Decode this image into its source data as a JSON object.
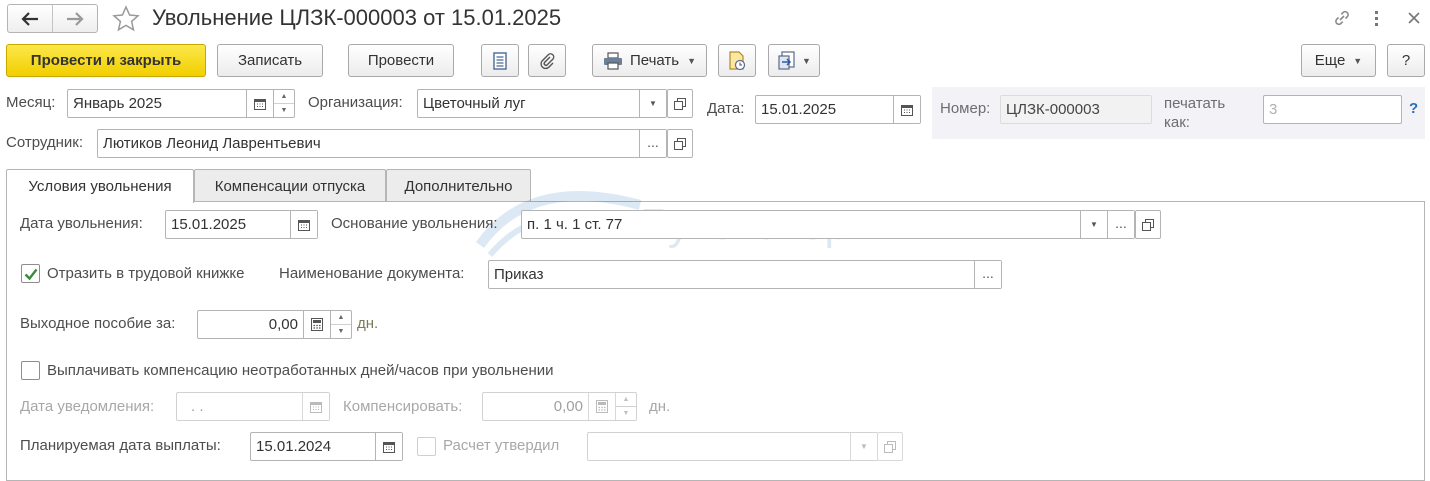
{
  "window": {
    "title": "Увольнение ЦЛЗК-000003 от 15.01.2025",
    "link_icon": "link-icon",
    "more_icon": "vertical-dots-icon",
    "close_icon": "close-icon"
  },
  "toolbar": {
    "post_close_label": "Провести и закрыть",
    "save_label": "Записать",
    "post_label": "Провести",
    "print_label": "Печать",
    "more_label": "Еще",
    "help_label": "?"
  },
  "header": {
    "month_label": "Месяц:",
    "month_value": "Январь 2025",
    "org_label": "Организация:",
    "org_value": "Цветочный луг",
    "date_label": "Дата:",
    "date_value": "15.01.2025",
    "number_label": "Номер:",
    "number_value": "ЦЛЗК-000003",
    "print_as_label_1": "печатать",
    "print_as_label_2": "как:",
    "print_as_placeholder": "3",
    "help_mark": "?",
    "employee_label": "Сотрудник:",
    "employee_value": "Лютиков Леонид Лаврентьевич"
  },
  "tabs": [
    {
      "label": "Условия увольнения",
      "active": true
    },
    {
      "label": "Компенсации отпуска",
      "active": false
    },
    {
      "label": "Дополнительно",
      "active": false
    }
  ],
  "form": {
    "dismissal_date_label": "Дата увольнения:",
    "dismissal_date_value": "15.01.2025",
    "basis_label": "Основание увольнения:",
    "basis_value": "п. 1 ч. 1 ст. 77",
    "labor_book_label": "Отразить в трудовой книжке",
    "labor_book_checked": true,
    "doc_name_label": "Наименование документа:",
    "doc_name_value": "Приказ",
    "severance_label": "Выходное пособие за:",
    "severance_value": "0,00",
    "days_unit": "дн.",
    "pay_comp_label": "Выплачивать компенсацию неотработанных дней/часов при увольнении",
    "pay_comp_checked": false,
    "notice_date_label": "Дата уведомления:",
    "notice_date_value": " .  .",
    "compensate_label": "Компенсировать:",
    "compensate_value": "0,00",
    "compensate_unit": "дн.",
    "payment_date_label": "Планируемая дата выплаты:",
    "payment_date_value": "15.01.2024",
    "calc_approved_label": "Расчет утвердил",
    "calc_approved_checked": false
  },
  "watermark": "Бухэксперт",
  "colors": {
    "primary_button": "#f2cf00",
    "checkbox_tick": "#3a8a3a",
    "help_blue": "#2a6ebb",
    "number_panel": "#f2f2f7"
  }
}
